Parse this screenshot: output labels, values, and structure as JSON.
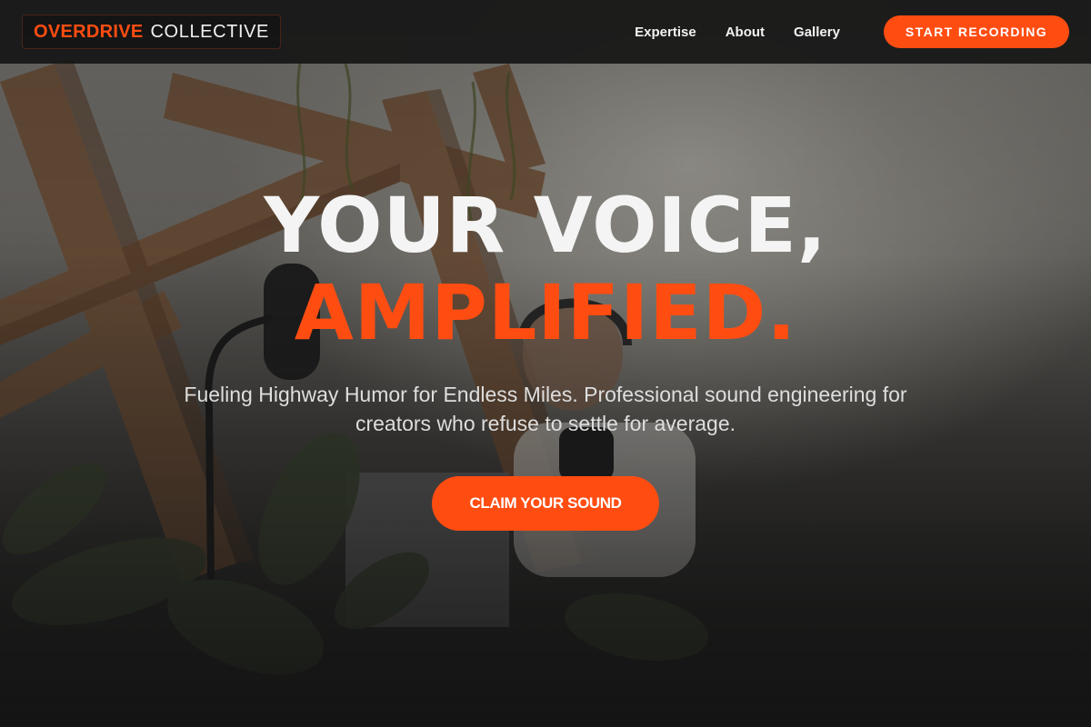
{
  "nav": {
    "logo_primary": "OVERDRIVE",
    "logo_secondary": "COLLECTIVE",
    "links": [
      "Expertise",
      "About",
      "Gallery"
    ],
    "cta_label": "START RECORDING"
  },
  "hero": {
    "headline_line1": "YOUR VOICE,",
    "headline_line2": "AMPLIFIED.",
    "subtitle": "Fueling Highway Humor for Endless Miles. Professional sound engineering for creators who refuse to settle for average.",
    "cta_label": "CLAIM YOUR SOUND"
  },
  "colors": {
    "accent": "#ff4d12",
    "nav_background": "#161616",
    "text_light": "#f4f4f4"
  },
  "icons": {
    "background_photo": "podcast-studio-photo"
  }
}
